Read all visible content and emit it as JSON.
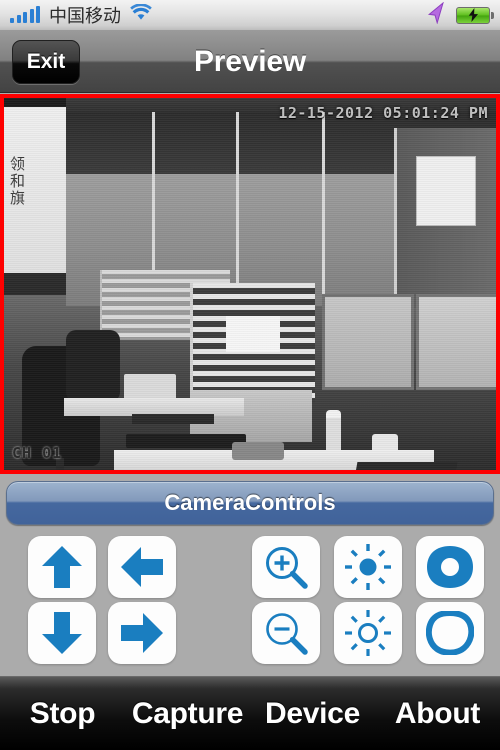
{
  "status_bar": {
    "signal_icon": "signal-bars-icon",
    "signal_bars": 5,
    "carrier": "中国移动",
    "wifi_icon": "wifi-icon",
    "location_icon": "location-arrow-icon",
    "battery_icon": "battery-charging-icon"
  },
  "nav_bar": {
    "exit_label": "Exit",
    "title": "Preview"
  },
  "video": {
    "timestamp": "12-15-2012 05:01:24 PM",
    "channel": "CH 01",
    "border_color": "#fe0000",
    "calligraphy": "领<br>和<br>旗"
  },
  "camera_controls": {
    "header_label": "CameraControls",
    "accent_blue": "#1a7ec0",
    "header_gradient_top": "#9db3ce",
    "header_gradient_bottom": "#41639a",
    "buttons": [
      {
        "name": "pan-up-button",
        "icon": "arrow-up-icon"
      },
      {
        "name": "pan-left-button",
        "icon": "arrow-left-icon"
      },
      {
        "name": "zoom-in-button",
        "icon": "magnifier-plus-icon"
      },
      {
        "name": "brightness-up-button",
        "icon": "sun-filled-icon"
      },
      {
        "name": "iris-open-button",
        "icon": "iris-open-icon"
      },
      {
        "name": "pan-down-button",
        "icon": "arrow-down-icon"
      },
      {
        "name": "pan-right-button",
        "icon": "arrow-right-icon"
      },
      {
        "name": "zoom-out-button",
        "icon": "magnifier-minus-icon"
      },
      {
        "name": "brightness-down-button",
        "icon": "sun-outline-icon"
      },
      {
        "name": "iris-close-button",
        "icon": "iris-close-icon"
      }
    ]
  },
  "tab_bar": {
    "tabs": [
      {
        "label": "Stop"
      },
      {
        "label": "Capture"
      },
      {
        "label": "Device"
      },
      {
        "label": "About"
      }
    ]
  },
  "background_color": "#ababab"
}
